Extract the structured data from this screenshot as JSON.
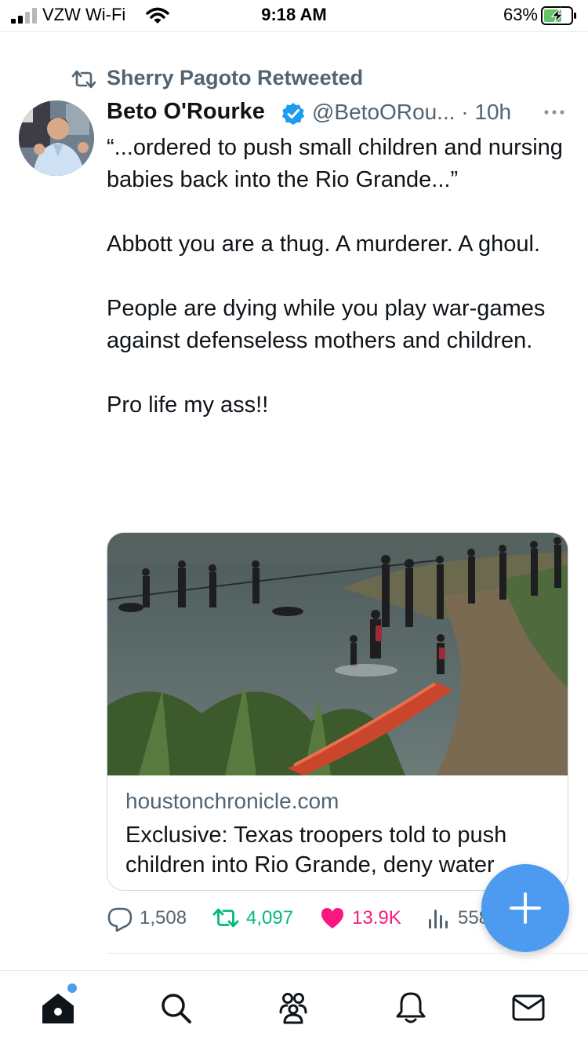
{
  "status_bar": {
    "carrier": "VZW Wi-Fi",
    "time": "9:18 AM",
    "battery_percent": "63%",
    "signal_icon": "signal-bars-icon",
    "wifi_icon": "wifi-icon",
    "battery_icon": "battery-charging-icon"
  },
  "retweet_header": {
    "icon": "retweet-icon",
    "label": "Sherry Pagoto Retweeted"
  },
  "tweet": {
    "author_name": "Beto O'Rourke",
    "verified_icon": "verified-badge-icon",
    "handle_time": "@BetoORou... · 10h",
    "body": [
      "“...ordered to push small children and nursing babies back into the Rio Grande...”",
      "Abbott you are a thug. A murderer. A ghoul.",
      "People are dying while you play war-games against defenseless mothers and children.",
      "Pro life my ass!!"
    ],
    "card": {
      "domain": "houstonchronicle.com",
      "title": "Exclusive: Texas troopers told to push children into Rio Grande, deny water"
    },
    "actions": {
      "replies": "1,508",
      "retweets": "4,097",
      "likes": "13.9K",
      "views": "558"
    }
  },
  "fab": {
    "icon": "plus-icon"
  },
  "tab_bar": {
    "items": [
      {
        "icon": "home-icon",
        "active": true
      },
      {
        "icon": "search-icon",
        "active": false
      },
      {
        "icon": "communities-icon",
        "active": false
      },
      {
        "icon": "bell-icon",
        "active": false
      },
      {
        "icon": "mail-icon",
        "active": false
      }
    ]
  },
  "colors": {
    "accent": "#4c9bf0",
    "secondary_text": "#536471",
    "retweet_green": "#00ba7c",
    "like_pink": "#f91880",
    "verified_blue": "#1d9bf0"
  }
}
